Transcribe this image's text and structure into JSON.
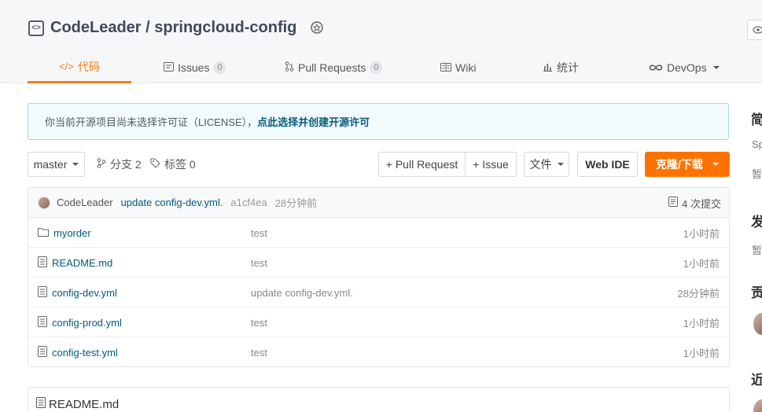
{
  "repo": {
    "owner": "CodeLeader",
    "separator": "/",
    "name": "springcloud-config"
  },
  "tabs": [
    {
      "label": "代码",
      "icon": "code-icon",
      "active": true
    },
    {
      "label": "Issues",
      "count": "0",
      "icon": "issues-icon"
    },
    {
      "label": "Pull Requests",
      "count": "0",
      "icon": "pull-request-icon"
    },
    {
      "label": "Wiki",
      "icon": "wiki-icon"
    },
    {
      "label": "统计",
      "icon": "stats-icon"
    },
    {
      "label": "DevOps",
      "icon": "devops-icon",
      "dropdown": true
    }
  ],
  "notice": {
    "text": "你当前开源项目尚未选择许可证（LICENSE），",
    "link": "点此选择并创建开源许可"
  },
  "toolbar": {
    "branch": "master",
    "branches_label": "分支 2",
    "tags_label": "标签 0",
    "pull_request": "+ Pull Request",
    "issue": "+ Issue",
    "file": "文件",
    "web_ide": "Web IDE",
    "clone": "克隆/下载"
  },
  "commit": {
    "author": "CodeLeader",
    "message": "update config-dev.yml.",
    "sha": "a1cf4ea",
    "time": "28分钟前",
    "count_label": "4 次提交"
  },
  "files": [
    {
      "name": "myorder",
      "type": "folder",
      "message": "test",
      "time": "1小时前"
    },
    {
      "name": "README.md",
      "type": "file",
      "message": "test",
      "time": "1小时前"
    },
    {
      "name": "config-dev.yml",
      "type": "file",
      "message": "update config-dev.yml.",
      "time": "28分钟前"
    },
    {
      "name": "config-prod.yml",
      "type": "file",
      "message": "test",
      "time": "1小时前"
    },
    {
      "name": "config-test.yml",
      "type": "file",
      "message": "test",
      "time": "1小时前"
    }
  ],
  "readme": {
    "title": "README.md"
  },
  "sidebar": {
    "intro_heading": "简",
    "intro_text": "Sp",
    "intro_none": "暂",
    "release_heading": "发",
    "release_none": "暂",
    "contrib_heading": "贡",
    "recent_heading": "近"
  },
  "colors": {
    "accent": "#fe7300",
    "link": "#005980",
    "notice_bg": "#f2fafc"
  }
}
